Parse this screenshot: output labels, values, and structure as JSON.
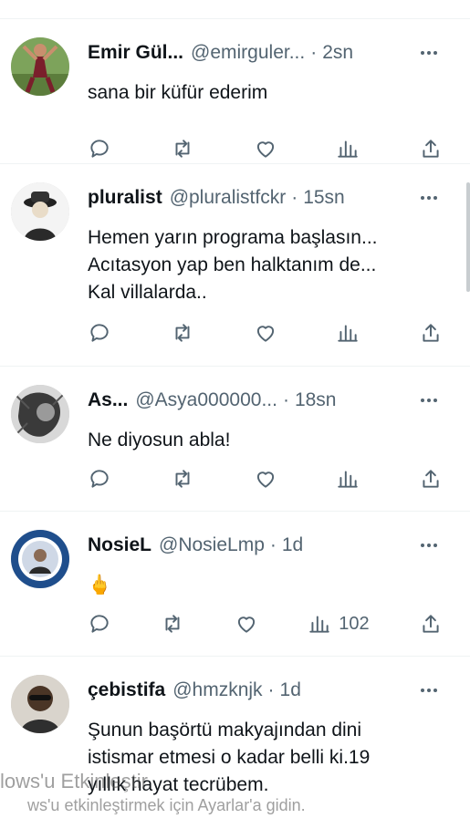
{
  "tweets": [
    {
      "name": "Emir Gül...",
      "handle": "@emirguler...",
      "time": "2sn",
      "text_lines": [
        "sana bir küfür ederim"
      ],
      "views": "",
      "avatar_icon": "profile-photo-dancer"
    },
    {
      "name": "pluralist",
      "handle": "@pluralistfckr",
      "time": "15sn",
      "text_lines": [
        "Hemen yarın programa başlasın...",
        "Acıtasyon yap ben halktanım de...",
        "Kal villalarda.."
      ],
      "views": "",
      "avatar_icon": "profile-photo-hat-man"
    },
    {
      "name": "As...",
      "handle": "@Asya000000...",
      "time": "18sn",
      "text_lines": [
        "Ne diyosun abla!"
      ],
      "views": "",
      "avatar_icon": "profile-photo-monochrome"
    },
    {
      "name": "NosieL",
      "handle": "@NosieLmp",
      "time": "1d",
      "text_lines": [
        "🖕"
      ],
      "views": "102",
      "avatar_icon": "profile-photo-badge"
    },
    {
      "name": "çebistifa",
      "handle": "@hmzknjk",
      "time": "1d",
      "text_lines": [
        "Şunun başörtü makyajından dini",
        "istismar etmesi o kadar belli ki.19",
        "yıllık hayat tecrübem."
      ],
      "views": "",
      "avatar_icon": "profile-photo-sunglasses"
    }
  ],
  "watermark": {
    "line1": "lows'u Etkinleştir",
    "line2": "ws'u etkinleştirmek için Ayarlar'a gidin."
  },
  "colors": {
    "text": "#0f1419",
    "secondary": "#536471",
    "divider": "#eff3f4"
  }
}
